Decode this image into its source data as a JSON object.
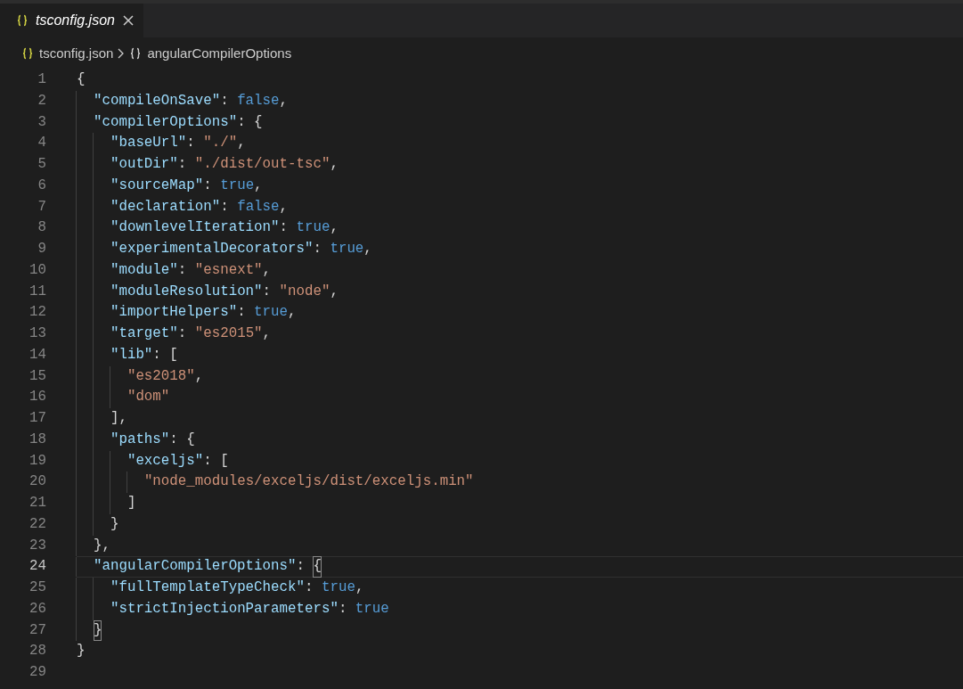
{
  "tabs": [
    {
      "label": "tsconfig.json",
      "selected": true
    }
  ],
  "breadcrumbs": [
    "tsconfig.json",
    "angularCompilerOptions"
  ],
  "lines": [
    {
      "number": "1",
      "current": false,
      "tokens": [
        {
          "kind": "punct",
          "text": "{"
        }
      ]
    },
    {
      "number": "2",
      "current": false,
      "tokens": [
        {
          "kind": "key",
          "text": "  \"compileOnSave\""
        },
        {
          "kind": "punct",
          "text": ": "
        },
        {
          "kind": "keyword",
          "text": "false"
        },
        {
          "kind": "punct",
          "text": ","
        }
      ]
    },
    {
      "number": "3",
      "current": false,
      "tokens": [
        {
          "kind": "key",
          "text": "  \"compilerOptions\""
        },
        {
          "kind": "punct",
          "text": ": {"
        }
      ]
    },
    {
      "number": "4",
      "current": false,
      "tokens": [
        {
          "kind": "key",
          "text": "    \"baseUrl\""
        },
        {
          "kind": "punct",
          "text": ": "
        },
        {
          "kind": "string",
          "text": "\"./\""
        },
        {
          "kind": "punct",
          "text": ","
        }
      ]
    },
    {
      "number": "5",
      "current": false,
      "tokens": [
        {
          "kind": "key",
          "text": "    \"outDir\""
        },
        {
          "kind": "punct",
          "text": ": "
        },
        {
          "kind": "string",
          "text": "\"./dist/out-tsc\""
        },
        {
          "kind": "punct",
          "text": ","
        }
      ]
    },
    {
      "number": "6",
      "current": false,
      "tokens": [
        {
          "kind": "key",
          "text": "    \"sourceMap\""
        },
        {
          "kind": "punct",
          "text": ": "
        },
        {
          "kind": "keyword",
          "text": "true"
        },
        {
          "kind": "punct",
          "text": ","
        }
      ]
    },
    {
      "number": "7",
      "current": false,
      "tokens": [
        {
          "kind": "key",
          "text": "    \"declaration\""
        },
        {
          "kind": "punct",
          "text": ": "
        },
        {
          "kind": "keyword",
          "text": "false"
        },
        {
          "kind": "punct",
          "text": ","
        }
      ]
    },
    {
      "number": "8",
      "current": false,
      "tokens": [
        {
          "kind": "key",
          "text": "    \"downlevelIteration\""
        },
        {
          "kind": "punct",
          "text": ": "
        },
        {
          "kind": "keyword",
          "text": "true"
        },
        {
          "kind": "punct",
          "text": ","
        }
      ]
    },
    {
      "number": "9",
      "current": false,
      "tokens": [
        {
          "kind": "key",
          "text": "    \"experimentalDecorators\""
        },
        {
          "kind": "punct",
          "text": ": "
        },
        {
          "kind": "keyword",
          "text": "true"
        },
        {
          "kind": "punct",
          "text": ","
        }
      ]
    },
    {
      "number": "10",
      "current": false,
      "tokens": [
        {
          "kind": "key",
          "text": "    \"module\""
        },
        {
          "kind": "punct",
          "text": ": "
        },
        {
          "kind": "string",
          "text": "\"esnext\""
        },
        {
          "kind": "punct",
          "text": ","
        }
      ]
    },
    {
      "number": "11",
      "current": false,
      "tokens": [
        {
          "kind": "key",
          "text": "    \"moduleResolution\""
        },
        {
          "kind": "punct",
          "text": ": "
        },
        {
          "kind": "string",
          "text": "\"node\""
        },
        {
          "kind": "punct",
          "text": ","
        }
      ]
    },
    {
      "number": "12",
      "current": false,
      "tokens": [
        {
          "kind": "key",
          "text": "    \"importHelpers\""
        },
        {
          "kind": "punct",
          "text": ": "
        },
        {
          "kind": "keyword",
          "text": "true"
        },
        {
          "kind": "punct",
          "text": ","
        }
      ]
    },
    {
      "number": "13",
      "current": false,
      "tokens": [
        {
          "kind": "key",
          "text": "    \"target\""
        },
        {
          "kind": "punct",
          "text": ": "
        },
        {
          "kind": "string",
          "text": "\"es2015\""
        },
        {
          "kind": "punct",
          "text": ","
        }
      ]
    },
    {
      "number": "14",
      "current": false,
      "tokens": [
        {
          "kind": "key",
          "text": "    \"lib\""
        },
        {
          "kind": "punct",
          "text": ": ["
        }
      ]
    },
    {
      "number": "15",
      "current": false,
      "tokens": [
        {
          "kind": "string",
          "text": "      \"es2018\""
        },
        {
          "kind": "punct",
          "text": ","
        }
      ]
    },
    {
      "number": "16",
      "current": false,
      "tokens": [
        {
          "kind": "string",
          "text": "      \"dom\""
        }
      ]
    },
    {
      "number": "17",
      "current": false,
      "tokens": [
        {
          "kind": "punct",
          "text": "    ],"
        }
      ]
    },
    {
      "number": "18",
      "current": false,
      "tokens": [
        {
          "kind": "key",
          "text": "    \"paths\""
        },
        {
          "kind": "punct",
          "text": ": {"
        }
      ]
    },
    {
      "number": "19",
      "current": false,
      "tokens": [
        {
          "kind": "key",
          "text": "      \"exceljs\""
        },
        {
          "kind": "punct",
          "text": ": ["
        }
      ]
    },
    {
      "number": "20",
      "current": false,
      "tokens": [
        {
          "kind": "string",
          "text": "        \"node_modules/exceljs/dist/exceljs.min\""
        }
      ]
    },
    {
      "number": "21",
      "current": false,
      "tokens": [
        {
          "kind": "punct",
          "text": "      ]"
        }
      ]
    },
    {
      "number": "22",
      "current": false,
      "tokens": [
        {
          "kind": "punct",
          "text": "    }"
        }
      ]
    },
    {
      "number": "23",
      "current": false,
      "tokens": [
        {
          "kind": "punct",
          "text": "  },"
        }
      ]
    },
    {
      "number": "24",
      "current": true,
      "tokens": [
        {
          "kind": "key",
          "text": "  \"angularCompilerOptions\""
        },
        {
          "kind": "punct",
          "text": ": "
        },
        {
          "kind": "bracket",
          "text": "{"
        }
      ]
    },
    {
      "number": "25",
      "current": false,
      "tokens": [
        {
          "kind": "key",
          "text": "    \"fullTemplateTypeCheck\""
        },
        {
          "kind": "punct",
          "text": ": "
        },
        {
          "kind": "keyword",
          "text": "true"
        },
        {
          "kind": "punct",
          "text": ","
        }
      ]
    },
    {
      "number": "26",
      "current": false,
      "tokens": [
        {
          "kind": "key",
          "text": "    \"strictInjectionParameters\""
        },
        {
          "kind": "punct",
          "text": ": "
        },
        {
          "kind": "keyword",
          "text": "true"
        }
      ]
    },
    {
      "number": "27",
      "current": false,
      "tokens": [
        {
          "kind": "bracket",
          "text": "  }"
        }
      ]
    },
    {
      "number": "28",
      "current": false,
      "tokens": [
        {
          "kind": "punct",
          "text": "}"
        }
      ]
    },
    {
      "number": "29",
      "current": false
    }
  ]
}
